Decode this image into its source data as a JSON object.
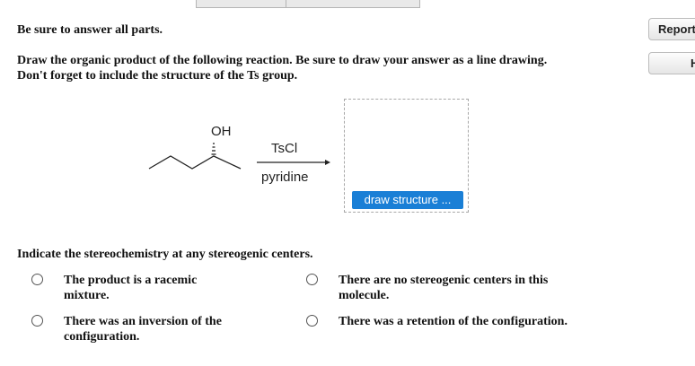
{
  "instructions": "Be sure to answer all parts.",
  "question": {
    "line1": "Draw the organic product of the following reaction. Be sure to draw your answer as a line drawing.",
    "line2": "Don't forget to include the structure of the Ts group."
  },
  "side_buttons": {
    "report_label": "Report",
    "second_label": "H"
  },
  "reaction": {
    "substituent": "OH",
    "reagent": "TsCl",
    "solvent": "pyridine"
  },
  "draw_button_label": "draw structure ...",
  "stereo_question": "Indicate the stereochemistry at any stereogenic centers.",
  "options": [
    {
      "label": "The product is a racemic mixture."
    },
    {
      "label": "There are no stereogenic centers in this molecule."
    },
    {
      "label": "There was an inversion of the configuration."
    },
    {
      "label": "There was a retention of the configuration."
    }
  ]
}
